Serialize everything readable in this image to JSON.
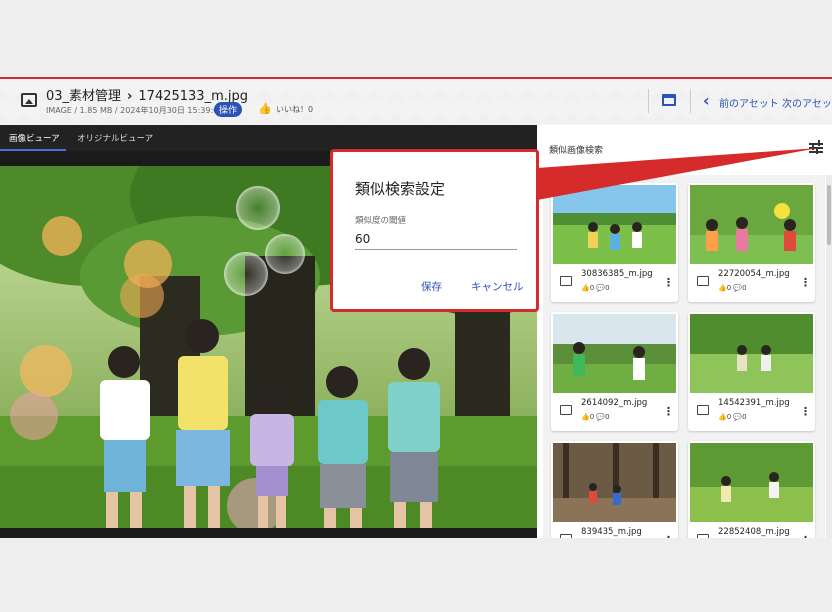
{
  "header": {
    "folder": "03_素材管理",
    "filename": "17425133_m.jpg",
    "meta": "IMAGE / 1.85 MB / 2024年10月30日 15:39:08",
    "ops_badge": "操作",
    "likes": "いいね！0",
    "prev_label": "前のアセット",
    "next_label": "次のアセット"
  },
  "viewer": {
    "tabs": [
      "画像ビューア",
      "オリジナルビューア"
    ],
    "active_tab": 0
  },
  "panel": {
    "title": "類似画像検索",
    "cards": [
      {
        "name": "30836385_m.jpg",
        "likes": "0",
        "comments": "0"
      },
      {
        "name": "22720054_m.jpg",
        "likes": "0",
        "comments": "0"
      },
      {
        "name": "2614092_m.jpg",
        "likes": "0",
        "comments": "0"
      },
      {
        "name": "14542391_m.jpg",
        "likes": "0",
        "comments": "0"
      },
      {
        "name": "839435_m.jpg",
        "likes": "0",
        "comments": "0"
      },
      {
        "name": "22852408_m.jpg",
        "likes": "0",
        "comments": "0"
      }
    ]
  },
  "dialog": {
    "title": "類似検索設定",
    "field_label": "類似度の閾値",
    "field_value": "60",
    "save": "保存",
    "cancel": "キャンセル"
  },
  "colors": {
    "accent": "#2c51b8",
    "highlight": "#d62b2b"
  }
}
